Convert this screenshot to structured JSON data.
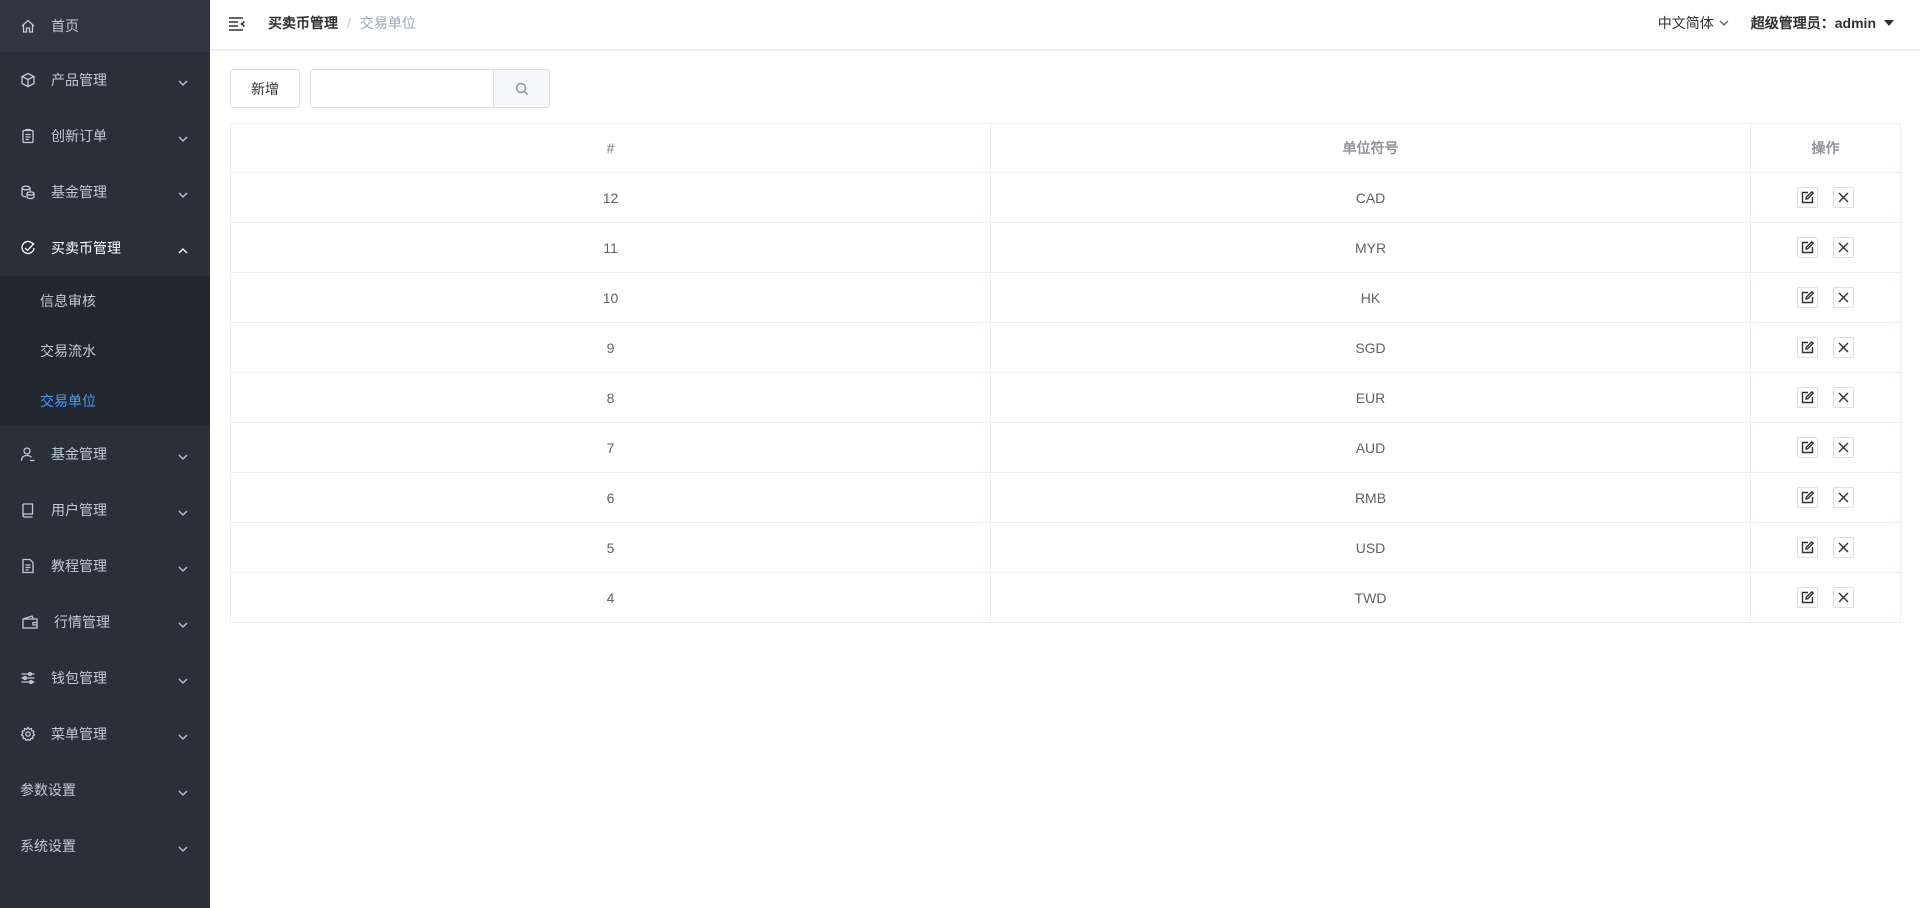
{
  "sidebar": {
    "home": {
      "label": "首页",
      "icon": "home-icon"
    },
    "items": [
      {
        "label": "产品管理",
        "icon": "box-icon"
      },
      {
        "label": "创新订单",
        "icon": "clipboard-icon"
      },
      {
        "label": "基金管理",
        "icon": "coins-icon"
      },
      {
        "label": "买卖币管理",
        "icon": "check-circle-icon"
      },
      {
        "label": "基金管理",
        "icon": "user-icon"
      },
      {
        "label": "用户管理",
        "icon": "book-icon"
      },
      {
        "label": "教程管理",
        "icon": "document-icon"
      },
      {
        "label": "行情管理",
        "icon": "wallet-icon"
      },
      {
        "label": "钱包管理",
        "icon": "sliders-icon"
      },
      {
        "label": "菜单管理",
        "icon": "gear-icon"
      },
      {
        "label": "参数设置",
        "icon": ""
      },
      {
        "label": "系统设置",
        "icon": ""
      }
    ],
    "submenu": [
      {
        "label": "信息审核"
      },
      {
        "label": "交易流水"
      },
      {
        "label": "交易单位"
      }
    ]
  },
  "header": {
    "breadcrumb_first": "买卖币管理",
    "breadcrumb_sep": "/",
    "breadcrumb_last": "交易单位",
    "language": "中文简体",
    "user": "超级管理员：admin"
  },
  "toolbar": {
    "add_label": "新增",
    "search_value": "",
    "search_placeholder": ""
  },
  "table": {
    "columns": [
      "#",
      "单位符号",
      "操作"
    ],
    "rows": [
      {
        "id": "12",
        "unit": "CAD"
      },
      {
        "id": "11",
        "unit": "MYR"
      },
      {
        "id": "10",
        "unit": "HK"
      },
      {
        "id": "9",
        "unit": "SGD"
      },
      {
        "id": "8",
        "unit": "EUR"
      },
      {
        "id": "7",
        "unit": "AUD"
      },
      {
        "id": "6",
        "unit": "RMB"
      },
      {
        "id": "5",
        "unit": "USD"
      },
      {
        "id": "4",
        "unit": "TWD"
      }
    ]
  },
  "colors": {
    "sidebar_bg": "#2b2f3a",
    "submenu_bg": "#232730",
    "active_link": "#409eff"
  }
}
